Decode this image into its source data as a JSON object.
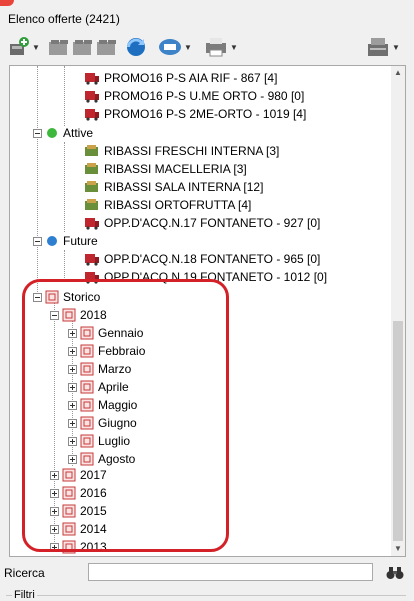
{
  "window": {
    "title": "Elenco offerte (2421)"
  },
  "search": {
    "label": "Ricerca",
    "value": ""
  },
  "filters": {
    "label": "Filtri"
  },
  "tree": {
    "promo_items": [
      "PROMO16 P-S AIA RIF - 867 [4]",
      "PROMO16 P-S U.ME ORTO - 980 [0]",
      "PROMO16 P-S 2ME-ORTO - 1019 [4]"
    ],
    "attive": {
      "label": "Attive",
      "items": [
        "RIBASSI FRESCHI INTERNA [3]",
        "RIBASSI MACELLERIA [3]",
        "RIBASSI SALA INTERNA [12]",
        "RIBASSI ORTOFRUTTA [4]",
        "OPP.D'ACQ.N.17 FONTANETO - 927 [0]"
      ]
    },
    "future": {
      "label": "Future",
      "items": [
        "OPP.D'ACQ.N.18 FONTANETO - 965 [0]",
        "OPP.D'ACQ.N.19 FONTANETO - 1012 [0]"
      ]
    },
    "storico": {
      "label": "Storico",
      "year_open": "2018",
      "months": [
        "Gennaio",
        "Febbraio",
        "Marzo",
        "Aprile",
        "Maggio",
        "Giugno",
        "Luglio",
        "Agosto"
      ],
      "years_closed": [
        "2017",
        "2016",
        "2015",
        "2014",
        "2013"
      ]
    }
  },
  "colors": {
    "highlight": "#d42128",
    "status_active": "#3db83d",
    "status_future": "#2f7fd1"
  }
}
